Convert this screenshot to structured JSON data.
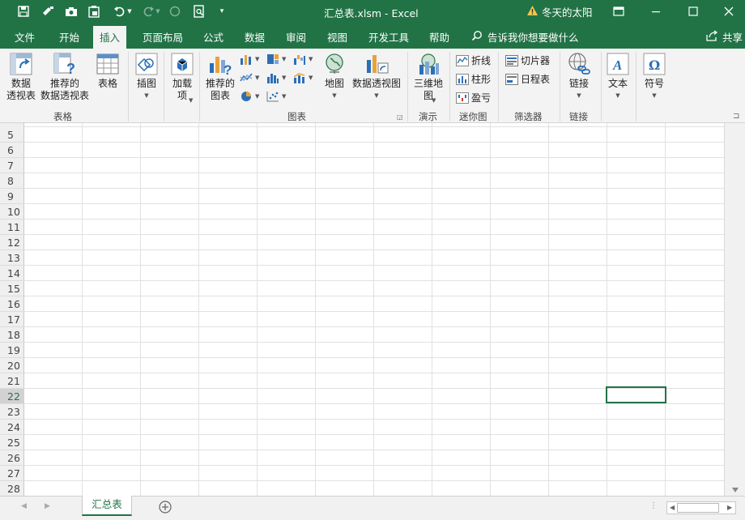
{
  "titlebar": {
    "title": "汇总表.xlsm  -  Excel",
    "user": "冬天的太阳",
    "quick_access": [
      "save-icon",
      "format-painter-icon",
      "camera-icon",
      "clipboard-icon",
      "undo-icon",
      "redo-icon",
      "circle-icon",
      "print-preview-icon",
      "customize-icon"
    ]
  },
  "tabs": [
    "文件",
    "开始",
    "插入",
    "页面布局",
    "公式",
    "数据",
    "审阅",
    "视图",
    "开发工具",
    "帮助"
  ],
  "active_tab": "插入",
  "tell_me": "告诉我你想要做什么",
  "share": "共享",
  "ribbon": {
    "pivot_table": "数据\n透视表",
    "recommended_pivot": "推荐的\n数据透视表",
    "table": "表格",
    "group_tables": "表格",
    "illustrations": "插图",
    "addins": "加载\n项",
    "recommended_charts": "推荐的\n图表",
    "maps": "地图",
    "pivot_chart": "数据透视图",
    "group_charts": "图表",
    "map3d": "三维地\n图",
    "group_tours": "演示",
    "spark_line": "折线",
    "spark_column": "柱形",
    "spark_winloss": "盈亏",
    "group_sparklines": "迷你图",
    "slicer": "切片器",
    "timeline": "日程表",
    "group_filters": "筛选器",
    "link": "链接",
    "group_links": "链接",
    "text": "文本",
    "symbol": "符号"
  },
  "rows": [
    "5",
    "6",
    "7",
    "8",
    "9",
    "10",
    "11",
    "12",
    "13",
    "14",
    "15",
    "16",
    "17",
    "18",
    "19",
    "20",
    "21",
    "22",
    "23",
    "24",
    "25",
    "26",
    "27",
    "28"
  ],
  "selected_row": "22",
  "sheet_tab": "汇总表",
  "colors": {
    "accent": "#217346"
  }
}
